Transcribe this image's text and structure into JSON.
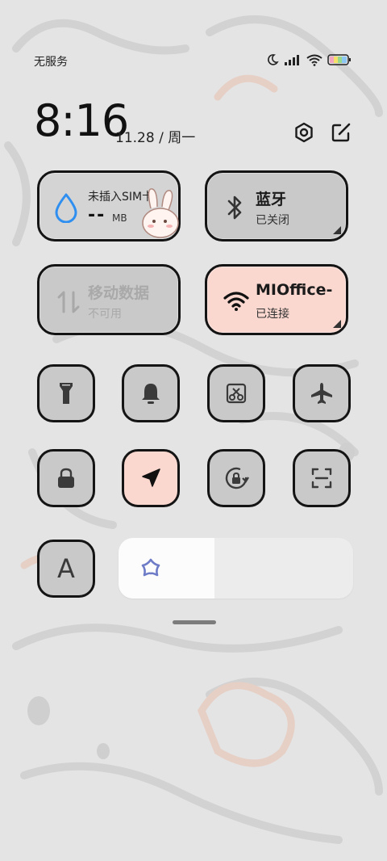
{
  "status_bar": {
    "carrier": "无服务",
    "icons": [
      "moon-icon",
      "signal-icon",
      "wifi-icon",
      "battery-icon"
    ]
  },
  "header": {
    "time": "8:16",
    "date": "11.28 / 周一",
    "icons": [
      "settings-icon",
      "edit-icon"
    ]
  },
  "tiles": {
    "data_usage": {
      "title": "未插入SIM卡",
      "value": "--",
      "unit": "MB",
      "icon": "droplet-icon"
    },
    "bluetooth": {
      "title": "蓝牙",
      "sub": "已关闭",
      "icon": "bluetooth-icon"
    },
    "mobile_data": {
      "title": "移动数据",
      "sub": "不可用",
      "icon": "mobile-data-icon"
    },
    "wifi": {
      "title": "MIOffice-",
      "sub": "已连接",
      "icon": "wifi-icon"
    }
  },
  "small_tiles": [
    {
      "name": "flashlight",
      "icon": "flashlight-icon",
      "active": false
    },
    {
      "name": "silent",
      "icon": "bell-icon",
      "active": false
    },
    {
      "name": "screenshot",
      "icon": "screenshot-icon",
      "active": false
    },
    {
      "name": "airplane",
      "icon": "airplane-icon",
      "active": false
    },
    {
      "name": "lock-screen",
      "icon": "lock-icon",
      "active": false
    },
    {
      "name": "location",
      "icon": "location-icon",
      "active": true
    },
    {
      "name": "rotation-lock",
      "icon": "rotation-lock-icon",
      "active": false
    },
    {
      "name": "scanner",
      "icon": "scan-icon",
      "active": false
    },
    {
      "name": "font-size",
      "label": "A",
      "active": false
    }
  ],
  "brightness": {
    "level": 0.41,
    "icon": "flower-icon"
  },
  "colors": {
    "tile_off": "#c9c9c9",
    "tile_on": "#fbd8cf",
    "border": "#141414",
    "accent_blue": "#2f8ff0"
  }
}
